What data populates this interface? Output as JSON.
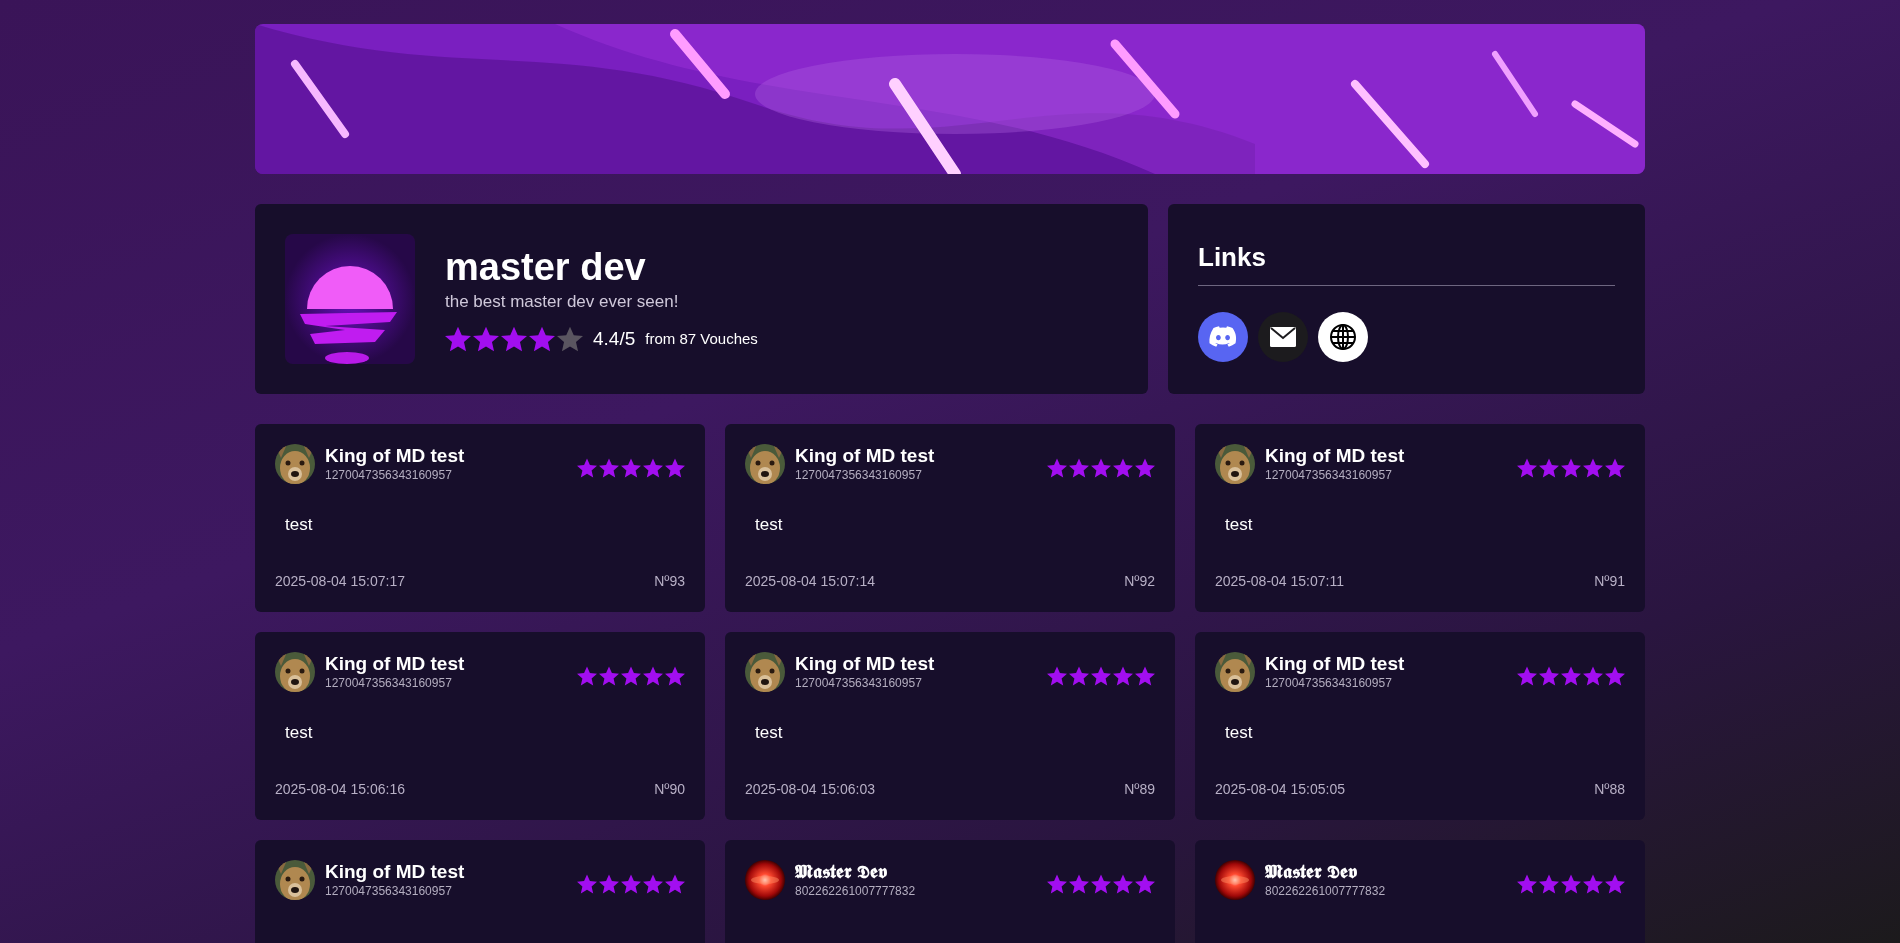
{
  "profile": {
    "name": "master dev",
    "bio": "the best master dev ever seen!",
    "stars": 4,
    "score": "4.4/5",
    "vouch_count": "from 87 Vouches"
  },
  "links": {
    "title": "Links",
    "items": [
      {
        "kind": "discord"
      },
      {
        "kind": "email"
      },
      {
        "kind": "website"
      }
    ]
  },
  "vouches": [
    {
      "kind": "dog",
      "name": "King of MD test",
      "user_id": "1270047356343160957",
      "stars": 5,
      "text": "test",
      "date": "2025-08-04 15:07:17",
      "number": "Nº93"
    },
    {
      "kind": "dog",
      "name": "King of MD test",
      "user_id": "1270047356343160957",
      "stars": 5,
      "text": "test",
      "date": "2025-08-04 15:07:14",
      "number": "Nº92"
    },
    {
      "kind": "dog",
      "name": "King of MD test",
      "user_id": "1270047356343160957",
      "stars": 5,
      "text": "test",
      "date": "2025-08-04 15:07:11",
      "number": "Nº91"
    },
    {
      "kind": "dog",
      "name": "King of MD test",
      "user_id": "1270047356343160957",
      "stars": 5,
      "text": "test",
      "date": "2025-08-04 15:06:16",
      "number": "Nº90"
    },
    {
      "kind": "dog",
      "name": "King of MD test",
      "user_id": "1270047356343160957",
      "stars": 5,
      "text": "test",
      "date": "2025-08-04 15:06:03",
      "number": "Nº89"
    },
    {
      "kind": "dog",
      "name": "King of MD test",
      "user_id": "1270047356343160957",
      "stars": 5,
      "text": "test",
      "date": "2025-08-04 15:05:05",
      "number": "Nº88"
    },
    {
      "kind": "dog",
      "name": "King of MD test",
      "user_id": "1270047356343160957",
      "stars": 5
    },
    {
      "kind": "orb",
      "name": "𝕸𝖆𝖘𝖙𝖊𝖗 𝕯𝖊𝖛",
      "user_id": "802262261007777832",
      "stars": 5
    },
    {
      "kind": "orb",
      "name": "𝕸𝖆𝖘𝖙𝖊𝖗 𝕯𝖊𝖛",
      "user_id": "802262261007777832",
      "stars": 5
    }
  ]
}
